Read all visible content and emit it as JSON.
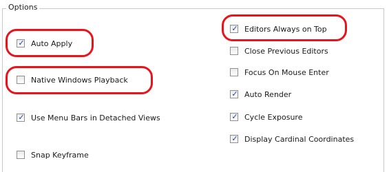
{
  "group": {
    "title": "Options"
  },
  "colors": {
    "highlight": "#e8141c",
    "checkmark": "#21469e"
  },
  "options_left": [
    {
      "label": "Auto Apply",
      "checked": true,
      "highlighted": true
    },
    {
      "label": "Native Windows Playback",
      "checked": false,
      "highlighted": true
    },
    {
      "label": "Use Menu Bars in Detached Views",
      "checked": true,
      "highlighted": false
    },
    {
      "label": "Snap Keyframe",
      "checked": false,
      "highlighted": false
    }
  ],
  "options_right": [
    {
      "label": "Editors Always on Top",
      "checked": true,
      "highlighted": true
    },
    {
      "label": "Close Previous Editors",
      "checked": false,
      "highlighted": false
    },
    {
      "label": "Focus On Mouse Enter",
      "checked": false,
      "highlighted": false
    },
    {
      "label": "Auto Render",
      "checked": true,
      "highlighted": false
    },
    {
      "label": "Cycle Exposure",
      "checked": true,
      "highlighted": false
    },
    {
      "label": "Display Cardinal Coordinates",
      "checked": true,
      "highlighted": false
    }
  ]
}
